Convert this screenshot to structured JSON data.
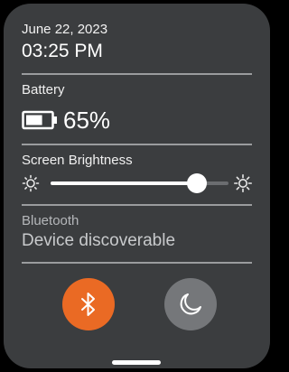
{
  "header": {
    "date": "June 22, 2023",
    "time": "03:25 PM"
  },
  "battery": {
    "label": "Battery",
    "value_text": "65%",
    "level": 0.65,
    "icon": "battery-icon"
  },
  "brightness": {
    "label": "Screen Brightness",
    "level": 0.82,
    "low_icon": "sun-low-icon",
    "high_icon": "sun-high-icon"
  },
  "bluetooth": {
    "label": "Bluetooth",
    "status": "Device discoverable"
  },
  "quick_actions": [
    {
      "name": "bluetooth-toggle",
      "icon": "bluetooth-icon",
      "active": true,
      "color": "#ea6a24"
    },
    {
      "name": "night-mode-toggle",
      "icon": "moon-icon",
      "active": false,
      "color": "#75777a"
    }
  ],
  "colors": {
    "panel": "#3b3d3f",
    "accent": "#ea6a24",
    "divider": "#9a9c9e"
  }
}
